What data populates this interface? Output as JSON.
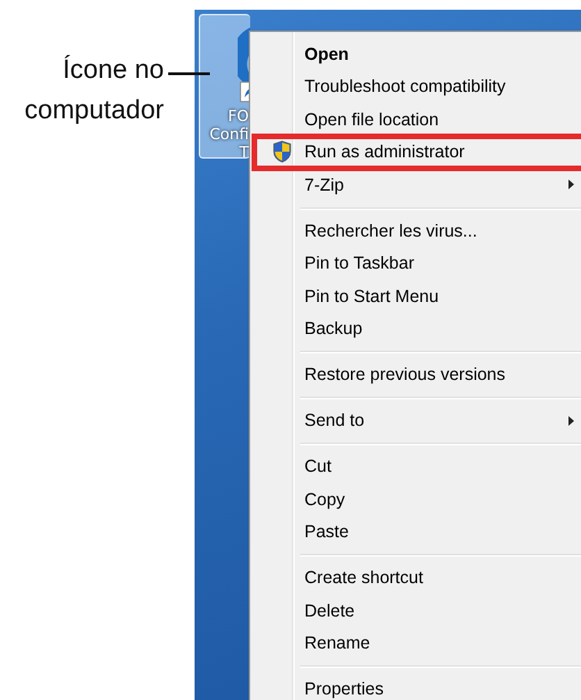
{
  "annotation": {
    "text": "Ícone no computador"
  },
  "desktop_icon": {
    "label_lines": [
      "FO",
      "Confi",
      "T"
    ],
    "selected": true
  },
  "context_menu": {
    "groups": [
      [
        {
          "label": "Open",
          "kind": "default",
          "highlighted": false
        },
        {
          "label": "Troubleshoot compatibility",
          "kind": "plain",
          "highlighted": false
        },
        {
          "label": "Open file location",
          "kind": "plain",
          "highlighted": false
        },
        {
          "label": "Run as administrator",
          "kind": "elevated",
          "highlighted": true
        },
        {
          "label": "7-Zip",
          "kind": "submenu",
          "highlighted": false
        }
      ],
      [
        {
          "label": "Rechercher les virus...",
          "kind": "plain",
          "highlighted": false
        },
        {
          "label": "Pin to Taskbar",
          "kind": "plain",
          "highlighted": false
        },
        {
          "label": "Pin to Start Menu",
          "kind": "plain",
          "highlighted": false
        },
        {
          "label": "Backup",
          "kind": "plain",
          "highlighted": false
        }
      ],
      [
        {
          "label": "Restore previous versions",
          "kind": "plain",
          "highlighted": false
        }
      ],
      [
        {
          "label": "Send to",
          "kind": "submenu",
          "highlighted": false
        }
      ],
      [
        {
          "label": "Cut",
          "kind": "plain",
          "highlighted": false
        },
        {
          "label": "Copy",
          "kind": "plain",
          "highlighted": false
        },
        {
          "label": "Paste",
          "kind": "plain",
          "highlighted": false
        }
      ],
      [
        {
          "label": "Create shortcut",
          "kind": "plain",
          "highlighted": false
        },
        {
          "label": "Delete",
          "kind": "plain",
          "highlighted": false
        },
        {
          "label": "Rename",
          "kind": "plain",
          "highlighted": false
        }
      ],
      [
        {
          "label": "Properties",
          "kind": "plain",
          "highlighted": false
        }
      ]
    ]
  }
}
